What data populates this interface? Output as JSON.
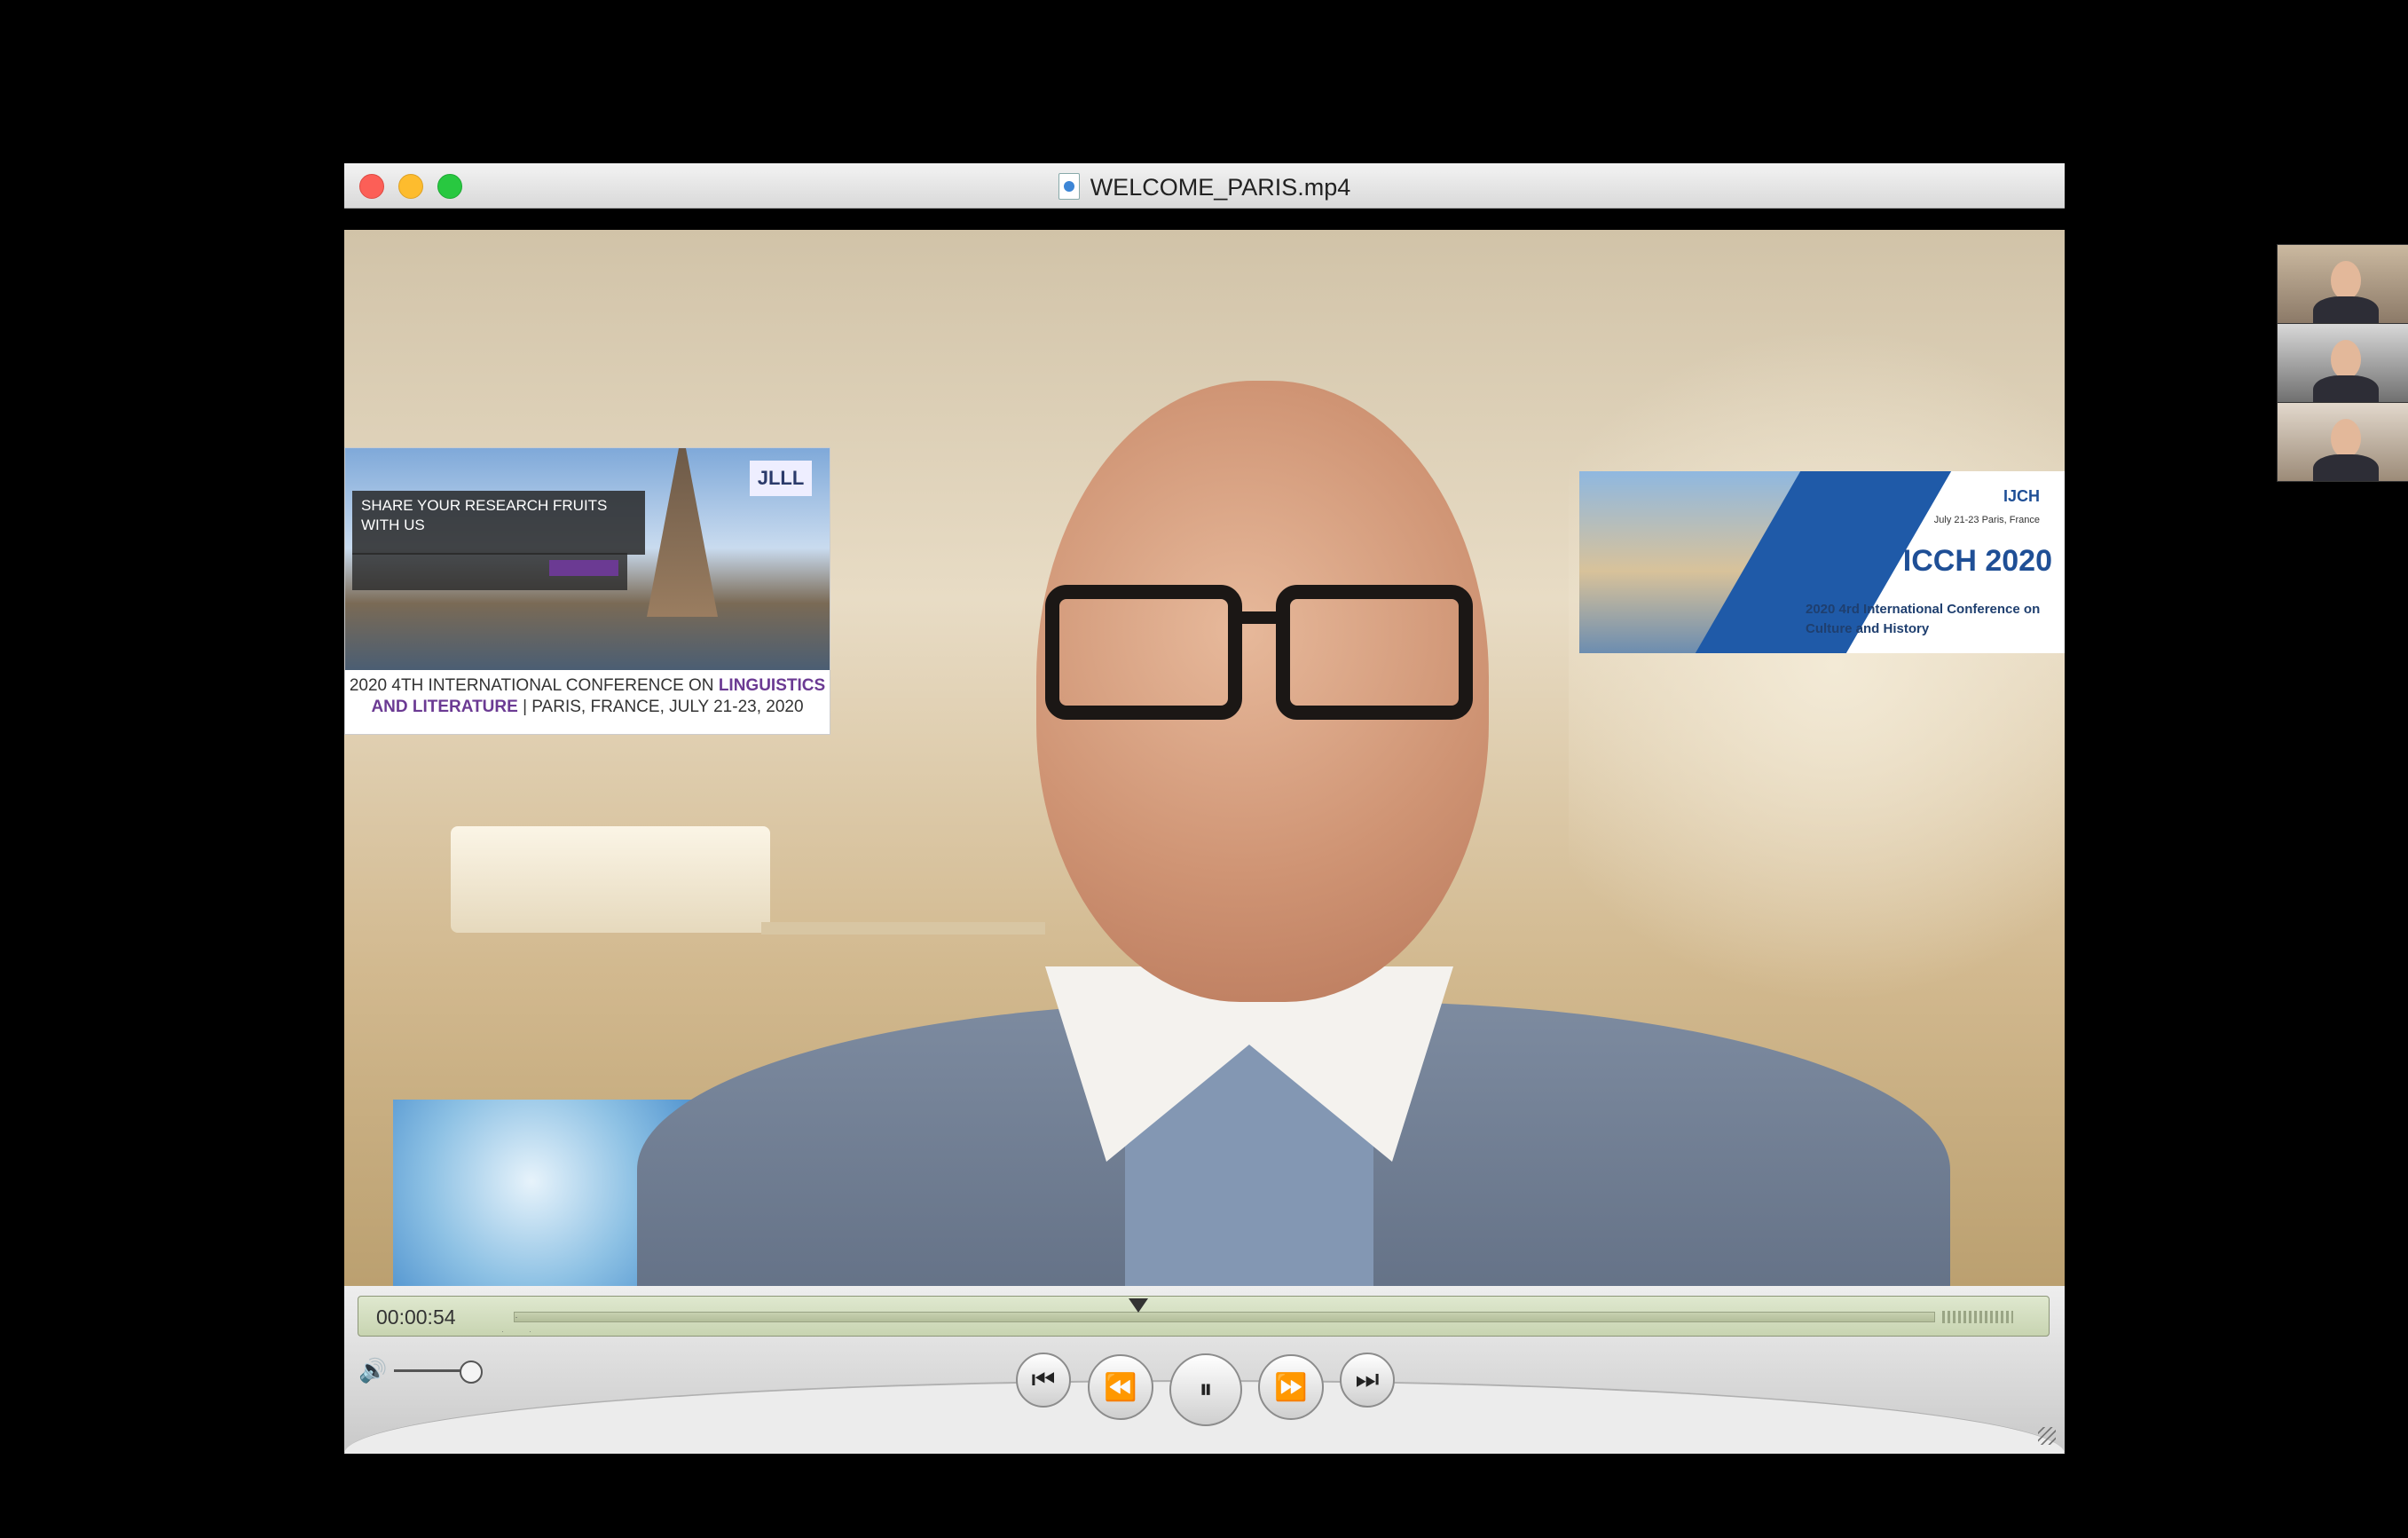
{
  "window": {
    "title": "WELCOME_PARIS.mp4",
    "file_icon": "quicktime-file-icon"
  },
  "banners": {
    "left": {
      "headline": "SHARE YOUR RESEARCH FRUITS WITH US",
      "logo": "JLLL",
      "caption_prefix": "2020 4TH INTERNATIONAL CONFERENCE ON",
      "caption_highlight": "LINGUISTICS AND LITERATURE",
      "caption_suffix": "| PARIS, FRANCE, JULY 21-23, 2020"
    },
    "right": {
      "logo": "IJCH",
      "date": "July 21-23 Paris, France",
      "title": "ICCH 2020",
      "subtitle": "2020 4rd International Conference on Culture and History"
    }
  },
  "player": {
    "time": "00:00:54",
    "progress": 0.44,
    "volume": 0.9,
    "buttons": {
      "start": "⏮",
      "rewind": "⏪",
      "pause": "⏸",
      "forward": "⏩",
      "end": "⏭"
    },
    "volume_icon": "🔊"
  },
  "participants": [
    "participant-1",
    "participant-2",
    "participant-3"
  ]
}
